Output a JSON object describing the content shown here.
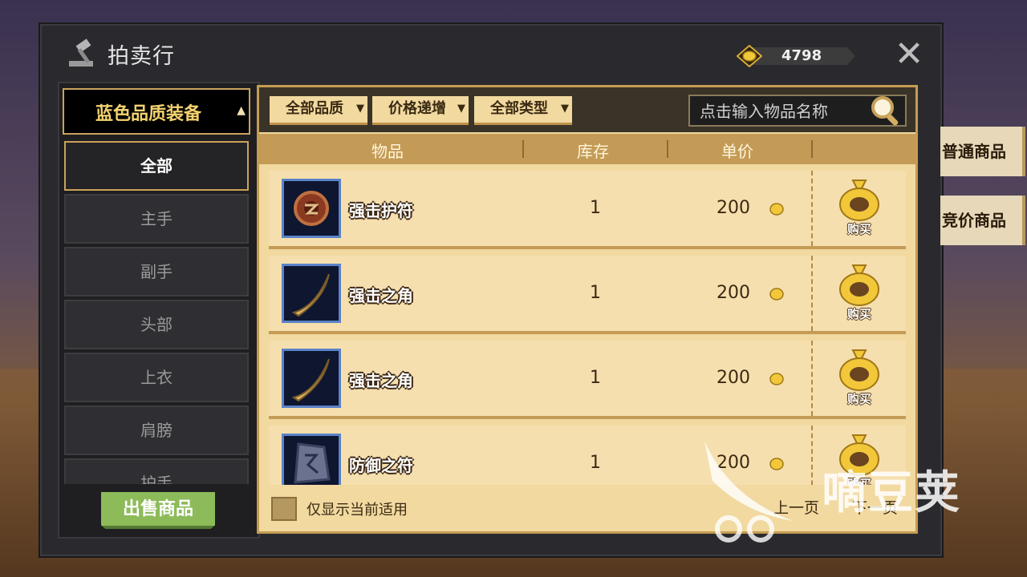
{
  "window": {
    "title": "拍卖行"
  },
  "currency": {
    "icon": "gold-coin-icon",
    "amount": "4798"
  },
  "category": {
    "current": "蓝色品质装备",
    "items": [
      {
        "label": "全部",
        "active": true
      },
      {
        "label": "主手"
      },
      {
        "label": "副手"
      },
      {
        "label": "头部"
      },
      {
        "label": "上衣"
      },
      {
        "label": "肩膀"
      },
      {
        "label": "护手"
      }
    ]
  },
  "filters": {
    "quality": "全部品质",
    "sort": "价格递增",
    "type": "全部类型"
  },
  "search": {
    "placeholder": "点击输入物品名称"
  },
  "columns": {
    "item": "物品",
    "stock": "库存",
    "price": "单价"
  },
  "listings": [
    {
      "name": "强击护符",
      "stock": "1",
      "price": "200",
      "icon": "amulet-icon",
      "buy": "购买"
    },
    {
      "name": "强击之角",
      "stock": "1",
      "price": "200",
      "icon": "horn-icon",
      "buy": "购买"
    },
    {
      "name": "强击之角",
      "stock": "1",
      "price": "200",
      "icon": "horn-icon",
      "buy": "购买"
    },
    {
      "name": "防御之符",
      "stock": "1",
      "price": "200",
      "icon": "rune-stone-icon",
      "buy": "购买"
    }
  ],
  "footer": {
    "only_usable": "仅显示当前适用",
    "prev": "上一页",
    "next": "下一页"
  },
  "sell_button": "出售商品",
  "side_tabs": [
    "普通商品",
    "竞价商品"
  ],
  "watermark": "嘀豆荚"
}
